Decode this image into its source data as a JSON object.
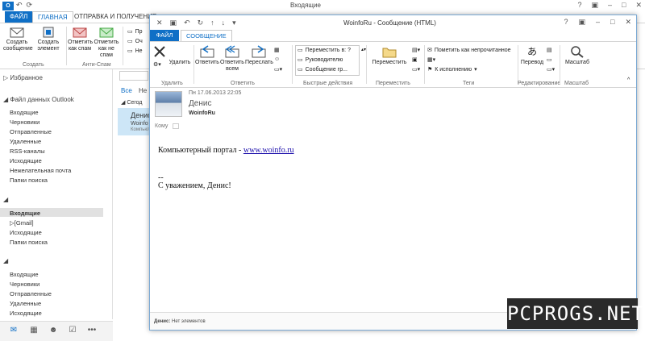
{
  "main": {
    "app_icon": "O",
    "title": "Входящие",
    "tabs": [
      "ФАЙЛ",
      "ГЛАВНАЯ",
      "ОТПРАВКА И ПОЛУЧЕНИЕ"
    ],
    "ribbon": {
      "create_label": "Создать сообщение",
      "create_item_label": "Создать элемент",
      "create_group": "Создать",
      "spam_label": "Отметить как спам",
      "not_spam_label": "Отметить как не спам",
      "spam_group": "Анти-Спам",
      "pr1": "Пр",
      "pr2": "Оч",
      "pr3": "Не"
    },
    "search_placeholder": "",
    "list_tab_all": "Все",
    "list_tab_unread": "Не",
    "list_group": "Сегод",
    "list_row_from": "Денис",
    "list_row_account": "Woinfo",
    "list_row_pc": "Компьютер"
  },
  "nav": {
    "favorites": "Избранное",
    "data_file": "Файл данных Outlook",
    "folders1": [
      "Входящие",
      "Черновики",
      "Отправленные",
      "Удаленные",
      "RSS-каналы",
      "Исходящие",
      "Нежелательная почта",
      "Папки поиска"
    ],
    "folders2": [
      "Входящие",
      "[Gmail]",
      "Исходящие",
      "Папки поиска"
    ],
    "folders3": [
      "Входящие",
      "Черновики",
      "Отправленные",
      "Удаленные",
      "Исходящие"
    ]
  },
  "msg": {
    "title": "WoinfoRu - Сообщение (HTML)",
    "tab_file": "ФАЙЛ",
    "tab_message": "СООБЩЕНИЕ",
    "ribbon": {
      "delete": "Удалить",
      "delete_group": "Удалить",
      "reply": "Ответить",
      "reply_all": "Ответить всем",
      "forward": "Переслать",
      "reply_group": "Ответить",
      "quick1": "Переместить в: ?",
      "quick2": "Руководителю",
      "quick3": "Сообщение гр...",
      "quick_group": "Быстрые действия",
      "move": "Переместить",
      "move_group": "Переместить",
      "mark_unread": "Пометить как непрочитанное",
      "followup": "К исполнению",
      "tags_group": "Теги",
      "translate": "Перевод",
      "edit_group": "Редактирование",
      "zoom": "Масштаб",
      "zoom_group": "Масштаб"
    },
    "date": "Пн 17.06.2013 22:05",
    "sender": "Денис",
    "account": "WoinfoRu",
    "to_label": "Кому",
    "body_prefix": "Компьютерный портал - ",
    "body_link": "www.woinfo.ru",
    "body_dash": "--",
    "body_sign": "С уважением, Денис!",
    "footer_name": "Денис:",
    "footer_text": "Нет элементов"
  },
  "watermark": "PCPROGS.NET"
}
